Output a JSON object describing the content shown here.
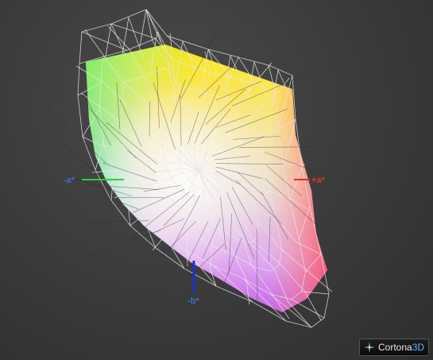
{
  "viewer": {
    "brand_name": "Cortona",
    "brand_suffix": "3D"
  },
  "axes": {
    "neg_a": "-a*",
    "pos_a": "+a*",
    "neg_b": "-b*"
  },
  "colors": {
    "neg_a_axis": "#2fd12f",
    "pos_a_axis": "#d8342c",
    "neg_b_axis": "#1f2fd6",
    "label_blue": "#3a6fd8"
  }
}
